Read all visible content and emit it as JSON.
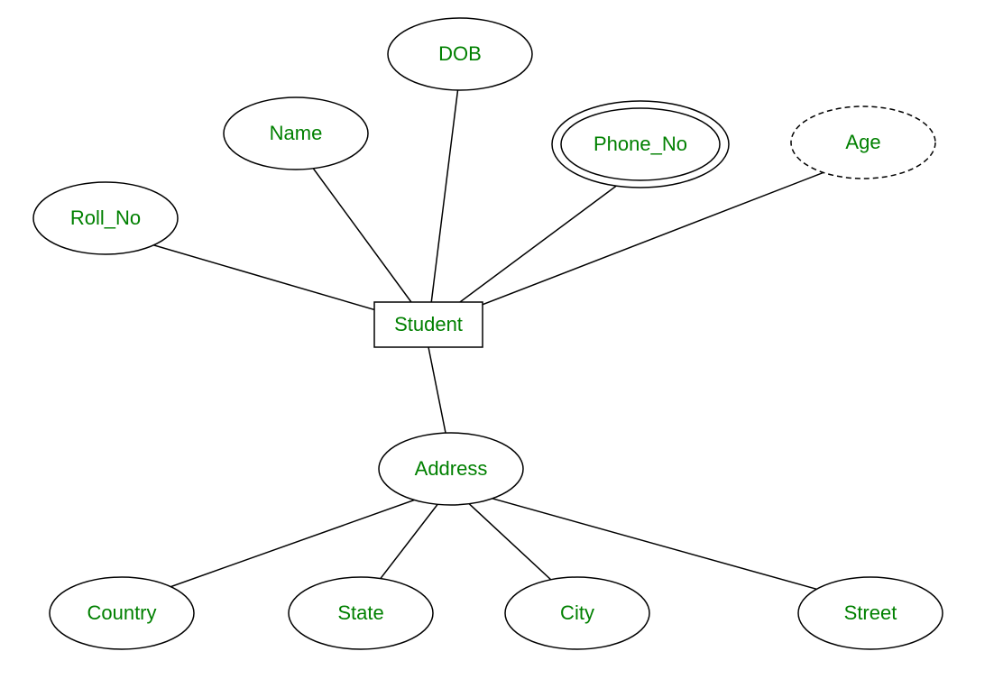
{
  "entity": {
    "name": "Student"
  },
  "attributes": {
    "roll_no": "Roll_No",
    "name": "Name",
    "dob": "DOB",
    "phone_no": "Phone_No",
    "age": "Age",
    "address": "Address"
  },
  "address_attributes": {
    "country": "Country",
    "state": "State",
    "city": "City",
    "street": "Street"
  },
  "colors": {
    "text": "#008000",
    "stroke": "#000000"
  }
}
